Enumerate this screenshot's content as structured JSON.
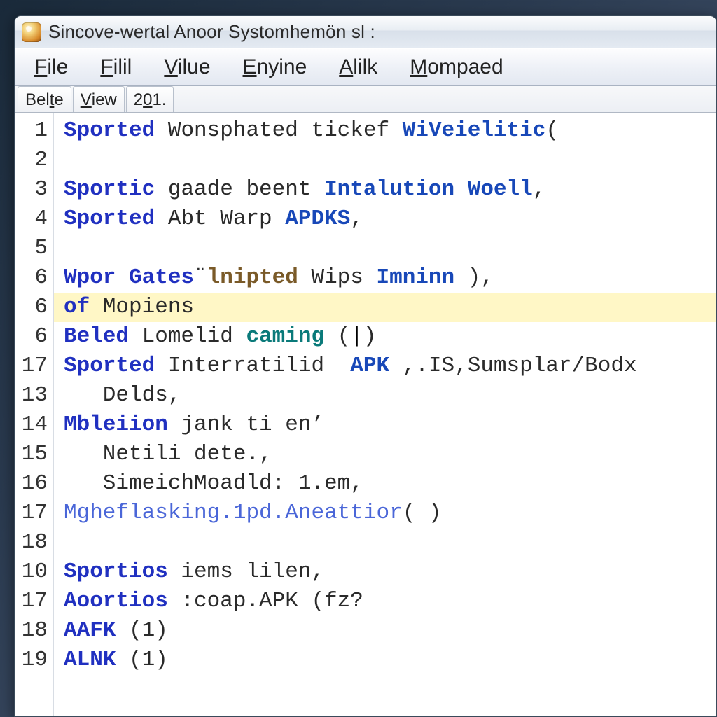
{
  "window": {
    "title": "Sincove-wertal Anoor Systomhemön sl :"
  },
  "menubar": {
    "items": [
      {
        "pre": "",
        "ul": "F",
        "post": "ile"
      },
      {
        "pre": "",
        "ul": "F",
        "post": "ilil"
      },
      {
        "pre": "",
        "ul": "V",
        "post": "ilue"
      },
      {
        "pre": "",
        "ul": "E",
        "post": "nyine"
      },
      {
        "pre": "",
        "ul": "A",
        "post": "lilk"
      },
      {
        "pre": "",
        "ul": "M",
        "post": "ompaed"
      }
    ]
  },
  "tabstrip": {
    "items": [
      {
        "pre": "Bel",
        "ul": "t",
        "post": "e"
      },
      {
        "pre": "",
        "ul": "V",
        "post": "iew"
      },
      {
        "pre": "2",
        "ul": "0",
        "post": "1."
      }
    ]
  },
  "editor": {
    "gutter": [
      "1",
      "2",
      "3",
      "4",
      "5",
      "6",
      "6",
      "6",
      "17",
      "13",
      "14",
      "15",
      "16",
      "17",
      "18",
      "10",
      "17",
      "18",
      "19"
    ],
    "lines": [
      {
        "hl": false,
        "segs": [
          {
            "t": "Sported",
            "c": "kw"
          },
          {
            "t": " Wonsphated tickef ",
            "c": "id"
          },
          {
            "t": "WiVeielitic",
            "c": "kw2"
          },
          {
            "t": "(",
            "c": "id"
          }
        ]
      },
      {
        "hl": false,
        "segs": []
      },
      {
        "hl": false,
        "segs": [
          {
            "t": "Sportic",
            "c": "kw"
          },
          {
            "t": " gaade beent ",
            "c": "id"
          },
          {
            "t": "Intalution Woell",
            "c": "kw2"
          },
          {
            "t": ",",
            "c": "id"
          }
        ]
      },
      {
        "hl": false,
        "segs": [
          {
            "t": "Sported",
            "c": "kw"
          },
          {
            "t": " Abt Warp ",
            "c": "id"
          },
          {
            "t": "APDKS",
            "c": "kw2"
          },
          {
            "t": ",",
            "c": "id"
          }
        ]
      },
      {
        "hl": false,
        "segs": []
      },
      {
        "hl": false,
        "segs": [
          {
            "t": "Wpor Gates",
            "c": "kw"
          },
          {
            "t": "¨",
            "c": "id"
          },
          {
            "t": "lnipted",
            "c": "brown"
          },
          {
            "t": " Wips ",
            "c": "id"
          },
          {
            "t": "Imninn",
            "c": "kw2"
          },
          {
            "t": " ),",
            "c": "id"
          }
        ]
      },
      {
        "hl": true,
        "segs": [
          {
            "t": "of",
            "c": "kw"
          },
          {
            "t": " Mopiens",
            "c": "id"
          }
        ]
      },
      {
        "hl": false,
        "segs": [
          {
            "t": "Beled",
            "c": "kw"
          },
          {
            "t": " Lomelid ",
            "c": "id"
          },
          {
            "t": "caming",
            "c": "teal"
          },
          {
            "t": " (",
            "c": "id"
          },
          {
            "t": "|",
            "c": "caret"
          },
          {
            "t": ")",
            "c": "id"
          }
        ]
      },
      {
        "hl": false,
        "segs": [
          {
            "t": "Sported",
            "c": "kw"
          },
          {
            "t": " Interratilid  ",
            "c": "id"
          },
          {
            "t": "APK",
            "c": "kw2"
          },
          {
            "t": " ,.IS,Sumsplar/Bodx",
            "c": "id"
          }
        ]
      },
      {
        "hl": false,
        "segs": [
          {
            "t": "   Delds,",
            "c": "id"
          }
        ]
      },
      {
        "hl": false,
        "segs": [
          {
            "t": "Mbleiion",
            "c": "kw"
          },
          {
            "t": " jank ti en’",
            "c": "id"
          }
        ]
      },
      {
        "hl": false,
        "segs": [
          {
            "t": "   Netili dete.,",
            "c": "id"
          }
        ]
      },
      {
        "hl": false,
        "segs": [
          {
            "t": "   SimeichMoadld: 1.em,",
            "c": "id"
          }
        ]
      },
      {
        "hl": false,
        "segs": [
          {
            "t": "Mgheflasking.1pd.Aneattior",
            "c": "fade"
          },
          {
            "t": "( )",
            "c": "id"
          }
        ]
      },
      {
        "hl": false,
        "segs": []
      },
      {
        "hl": false,
        "segs": [
          {
            "t": "Sportios",
            "c": "kw"
          },
          {
            "t": " iems lilen,",
            "c": "id"
          }
        ]
      },
      {
        "hl": false,
        "segs": [
          {
            "t": "Aoortios",
            "c": "kw"
          },
          {
            "t": " :coap.APK (fz?",
            "c": "id"
          }
        ]
      },
      {
        "hl": false,
        "segs": [
          {
            "t": "AAFK",
            "c": "kw"
          },
          {
            "t": " (1)",
            "c": "id"
          }
        ]
      },
      {
        "hl": false,
        "segs": [
          {
            "t": "ALNK",
            "c": "kw"
          },
          {
            "t": " (1)",
            "c": "id"
          }
        ]
      }
    ]
  }
}
